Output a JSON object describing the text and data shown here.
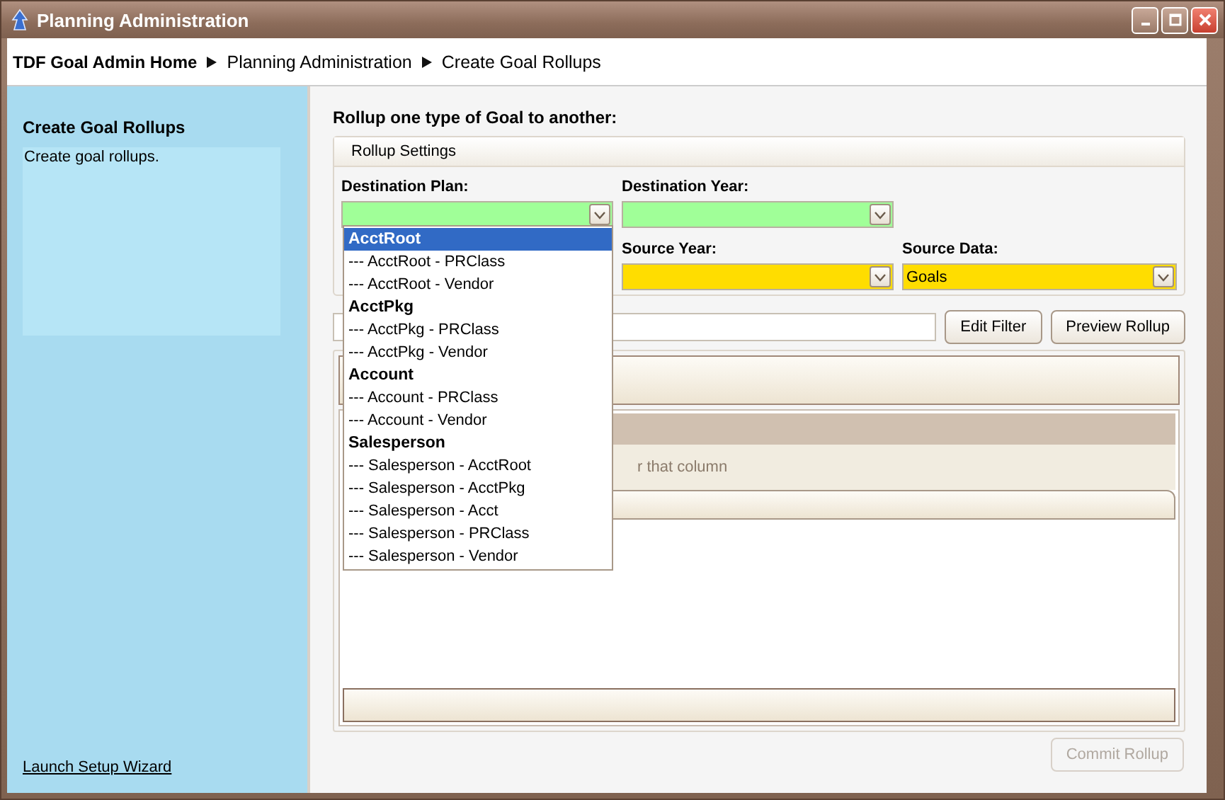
{
  "window": {
    "title": "Planning Administration"
  },
  "breadcrumb": [
    {
      "label": "TDF Goal Admin Home",
      "kind": "home"
    },
    {
      "label": "Planning Administration",
      "kind": "page"
    },
    {
      "label": "Create Goal Rollups",
      "kind": "page"
    }
  ],
  "sidebar": {
    "title": "Create Goal Rollups",
    "description": "Create goal rollups.",
    "link": "Launch Setup Wizard"
  },
  "main": {
    "heading": "Rollup one type of Goal to another:",
    "settings": {
      "title": "Rollup Settings",
      "rows": [
        {
          "fields": [
            {
              "label": "Destination Plan:",
              "color": "#a0ff98",
              "expanded": true
            },
            {
              "label": "Destination Year:",
              "color": "#a0ff98",
              "expanded": false
            }
          ]
        },
        {
          "fields": [
            {
              "label": "Source Year:",
              "color": "#ffdd00",
              "expanded": false
            },
            {
              "label": "Source Data:",
              "value": "Goals",
              "color": "#ffdd00",
              "expanded": false
            }
          ]
        }
      ]
    },
    "dropdown": {
      "items": [
        {
          "label": "AcctRoot",
          "kind": "group",
          "selected": true
        },
        {
          "label": "--- AcctRoot - PRClass",
          "kind": "option",
          "selected": false
        },
        {
          "label": "--- AcctRoot - Vendor",
          "kind": "option",
          "selected": false
        },
        {
          "label": "AcctPkg",
          "kind": "group",
          "selected": false
        },
        {
          "label": "--- AcctPkg - PRClass",
          "kind": "option",
          "selected": false
        },
        {
          "label": "--- AcctPkg - Vendor",
          "kind": "option",
          "selected": false
        },
        {
          "label": "Account",
          "kind": "group",
          "selected": false
        },
        {
          "label": "--- Account - PRClass",
          "kind": "option",
          "selected": false
        },
        {
          "label": "--- Account - Vendor",
          "kind": "option",
          "selected": false
        },
        {
          "label": "Salesperson",
          "kind": "group",
          "selected": false
        },
        {
          "label": "--- Salesperson - AcctRoot",
          "kind": "option",
          "selected": false
        },
        {
          "label": "--- Salesperson - AcctPkg",
          "kind": "option",
          "selected": false
        },
        {
          "label": "--- Salesperson - Acct",
          "kind": "option",
          "selected": false
        },
        {
          "label": "--- Salesperson - PRClass",
          "kind": "option",
          "selected": false
        },
        {
          "label": "--- Salesperson - Vendor",
          "kind": "option",
          "selected": false
        }
      ]
    },
    "filter_buttons": [
      {
        "label": "Edit Filter",
        "disabled": false
      },
      {
        "label": "Preview Rollup",
        "disabled": false
      }
    ],
    "grid": {
      "hint": "r that column"
    },
    "commit": {
      "label": "Commit Rollup",
      "disabled": true
    }
  }
}
